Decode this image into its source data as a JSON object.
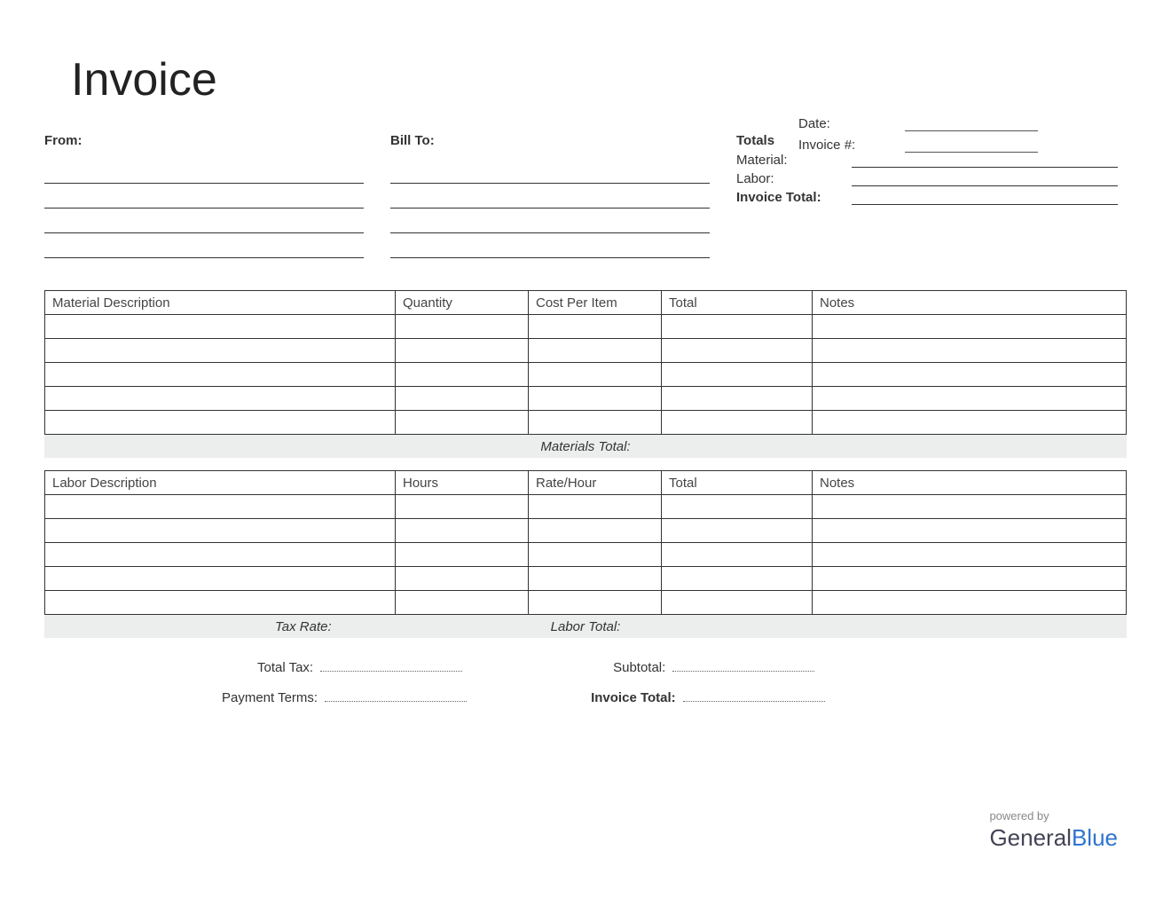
{
  "title": "Invoice",
  "meta": {
    "date_label": "Date:",
    "invoice_num_label": "Invoice #:"
  },
  "from": {
    "heading": "From:"
  },
  "bill_to": {
    "heading": "Bill To:"
  },
  "totals": {
    "heading": "Totals",
    "material_label": "Material:",
    "labor_label": "Labor:",
    "invoice_total_label": "Invoice Total:"
  },
  "materials_table": {
    "headers": {
      "description": "Material Description",
      "quantity": "Quantity",
      "cost": "Cost Per Item",
      "total": "Total",
      "notes": "Notes"
    },
    "rows": [
      "",
      "",
      "",
      "",
      ""
    ],
    "section_total_label": "Materials Total:"
  },
  "labor_table": {
    "headers": {
      "description": "Labor Description",
      "hours": "Hours",
      "rate": "Rate/Hour",
      "total": "Total",
      "notes": "Notes"
    },
    "rows": [
      "",
      "",
      "",
      "",
      ""
    ],
    "tax_rate_label": "Tax Rate:",
    "section_total_label": "Labor Total:"
  },
  "footer": {
    "total_tax_label": "Total Tax:",
    "subtotal_label": "Subtotal:",
    "payment_terms_label": "Payment Terms:",
    "invoice_total_label": "Invoice Total:"
  },
  "branding": {
    "powered_by": "powered by",
    "brand_part1": "General",
    "brand_part2": "Blue"
  }
}
